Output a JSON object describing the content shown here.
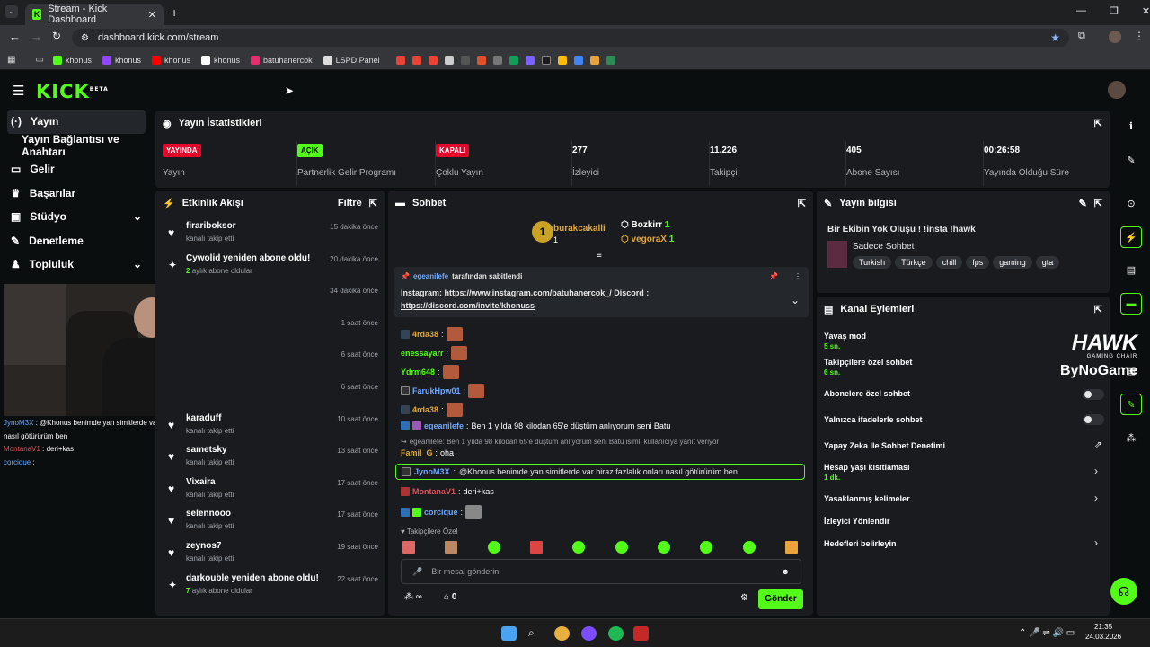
{
  "browser": {
    "tab_title": "Stream - Kick Dashboard",
    "url": "dashboard.kick.com/stream",
    "bookmarks": [
      {
        "label": "khonus",
        "icon": "kick-icon",
        "color": "#53fc18"
      },
      {
        "label": "khonus",
        "icon": "twitch-icon",
        "color": "#9146ff"
      },
      {
        "label": "khonus",
        "icon": "youtube-icon",
        "color": "#ff0000"
      },
      {
        "label": "khonus",
        "icon": "x-icon",
        "color": "#ffffff"
      },
      {
        "label": "batuhanercok",
        "icon": "instagram-icon",
        "color": "#e1306c"
      },
      {
        "label": "LSPD Panel",
        "icon": "lspd-icon",
        "color": "#dddddd"
      }
    ]
  },
  "app": {
    "logo": "KICK",
    "logo_sup": "BETA"
  },
  "sidebar": {
    "items": [
      {
        "label": "Yayın",
        "icon": "broadcast-icon"
      },
      {
        "label": "Yayın Bağlantısı ve Anahtarı",
        "icon": ""
      },
      {
        "label": "Gelir",
        "icon": "money-icon"
      },
      {
        "label": "Başarılar",
        "icon": "trophy-icon"
      },
      {
        "label": "Stüdyo",
        "icon": "studio-icon"
      },
      {
        "label": "Denetleme",
        "icon": "wrench-icon"
      },
      {
        "label": "Topluluk",
        "icon": "community-icon"
      }
    ]
  },
  "stats": {
    "title": "Yayın İstatistikleri",
    "items": [
      {
        "value": "YAYINDA",
        "label": "Yayın",
        "badge": "red"
      },
      {
        "value": "AÇIK",
        "label": "Partnerlik Gelir Programı",
        "badge": "green"
      },
      {
        "value": "KAPALI",
        "label": "Çoklu Yayın",
        "badge": "red"
      },
      {
        "value": "277",
        "label": "İzleyici"
      },
      {
        "value": "11.226",
        "label": "Takipçi"
      },
      {
        "value": "405",
        "label": "Abone Sayısı"
      },
      {
        "value": "00:26:58",
        "label": "Yayında Olduğu Süre"
      }
    ]
  },
  "activity": {
    "title": "Etkinlik Akışı",
    "filter": "Filtre",
    "items": [
      {
        "name": "firariboksor",
        "sub": "kanalı takip etti",
        "time": "15 dakika önce",
        "icon": "heart-icon"
      },
      {
        "name": "Cywolid yeniden abone oldu!",
        "sub_num": "2",
        "sub": "aylık abone oldular",
        "time": "20 dakika önce",
        "icon": "sparkle-icon"
      },
      {
        "name": "",
        "sub": "",
        "time": "34 dakika önce",
        "icon": ""
      },
      {
        "name": "",
        "sub": "",
        "time": "1 saat önce",
        "icon": ""
      },
      {
        "name": "",
        "sub": "",
        "time": "6 saat önce",
        "icon": ""
      },
      {
        "name": "",
        "sub": "",
        "time": "6 saat önce",
        "icon": ""
      },
      {
        "name": "karaduff",
        "sub": "kanalı takip etti",
        "time": "10 saat önce",
        "icon": "heart-icon"
      },
      {
        "name": "sametsky",
        "sub": "kanalı takip etti",
        "time": "13 saat önce",
        "icon": "heart-icon"
      },
      {
        "name": "Vixaira",
        "sub": "kanalı takip etti",
        "time": "17 saat önce",
        "icon": "heart-icon"
      },
      {
        "name": "selennooo",
        "sub": "kanalı takip etti",
        "time": "17 saat önce",
        "icon": "heart-icon"
      },
      {
        "name": "zeynos7",
        "sub": "kanalı takip etti",
        "time": "19 saat önce",
        "icon": "heart-icon"
      },
      {
        "name": "darkouble yeniden abone oldu!",
        "sub_num": "7",
        "sub": "aylık abone oldular",
        "time": "22 saat önce",
        "icon": "sparkle-icon"
      }
    ]
  },
  "overlay_chat": [
    {
      "user": "JynoM3X",
      "text": "@Khonus benimde yan simitlerde var biraz fazlalık onları nasıl götürürüm ben"
    },
    {
      "user": "MontanaV1",
      "text": "deri+kas"
    },
    {
      "user": "corcique",
      "text": ""
    }
  ],
  "chat": {
    "title": "Sohbet",
    "leaders": [
      {
        "name": "burakcakalli",
        "count": "1"
      },
      {
        "name": "Bozkirr",
        "count": "1"
      },
      {
        "name": "vegoraX",
        "count": "1"
      }
    ],
    "pinned_by": "egeanilefe",
    "pinned_suffix": "tarafından sabitlendi",
    "pinned_text": "Instagram:",
    "pinned_link1": "https://www.instagram.com/batuhanercok_/",
    "pinned_mid": "Discord :",
    "pinned_link2": "https://discord.com/invite/khonuss",
    "messages": [
      {
        "user": "4rda38",
        "text": ""
      },
      {
        "user": "enessayarr",
        "text": ""
      },
      {
        "user": "Ydrm648",
        "text": ""
      },
      {
        "user": "FarukHpw01",
        "text": ""
      },
      {
        "user": "4rda38",
        "text": ""
      },
      {
        "user": "egeanilefe",
        "text": "Ben 1 yılda 98 kilodan 65'e düştüm anlıyorum seni Batu"
      }
    ],
    "reply_note": "egeanilefe: Ben 1 yılda 98 kilodan 65'e düştüm anlıyorum seni Batu isimli kullanıcıya yanıt veriyor",
    "reply_user": "Famil_G",
    "reply_text": "oha",
    "highlight_user": "JynoM3X",
    "highlight_text": "@Khonus benimde yan simitlerde var biraz fazlalık onları nasıl götürürüm ben",
    "msg_montana_user": "MontanaV1",
    "msg_montana_text": "deri+kas",
    "msg_corcique_user": "corcique",
    "emote_section": "Takipçilere Özel",
    "input_placeholder": "Bir mesaj gönderin",
    "points": "0",
    "send": "Gönder"
  },
  "stream_info": {
    "title": "Yayın bilgisi",
    "stream_title": "Bir Ekibin Yok Oluşu ! !insta !hawk",
    "category": "Sadece Sohbet",
    "tags": [
      "Turkish",
      "Türkçe",
      "chill",
      "fps",
      "gaming",
      "gta"
    ]
  },
  "channel_actions": {
    "title": "Kanal Eylemleri",
    "items": [
      {
        "label": "Yavaş mod",
        "value": "5 sn."
      },
      {
        "label": "Takipçilere özel sohbet",
        "value": "6 sn."
      },
      {
        "label": "Abonelere özel sohbet",
        "value": ""
      },
      {
        "label": "Yalnızca ifadelerle sohbet",
        "value": ""
      },
      {
        "label": "Yapay Zeka ile Sohbet Denetimi",
        "value": ""
      },
      {
        "label": "Hesap yaşı kısıtlaması",
        "value": "1 dk."
      },
      {
        "label": "Yasaklanmış kelimeler",
        "value": ""
      },
      {
        "label": "İzleyici Yönlendir",
        "value": ""
      },
      {
        "label": "Hedefleri belirleyin",
        "value": ""
      }
    ]
  },
  "watermark": {
    "line1": "HAWK",
    "line2": "GAMING CHAIR",
    "line3": "ByNoGame"
  },
  "taskbar": {
    "time": "21:35",
    "date": "24.03.2026"
  }
}
